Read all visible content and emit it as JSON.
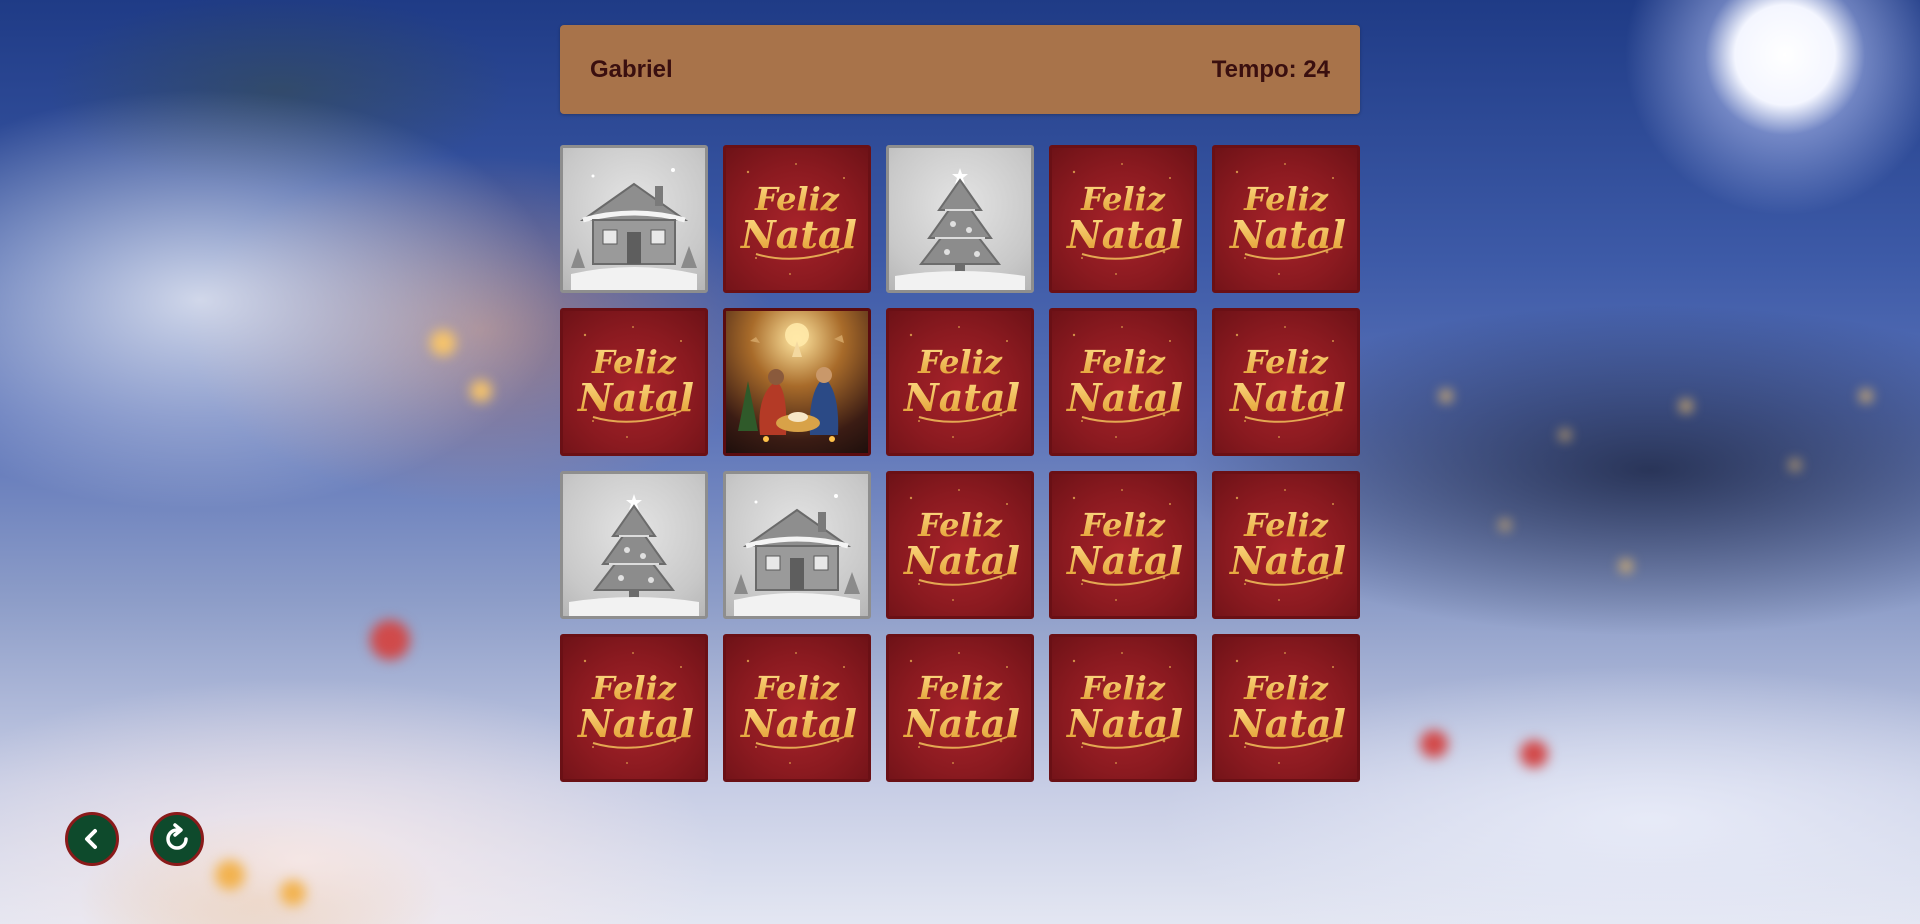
{
  "header": {
    "player_name": "Gabriel",
    "timer_label": "Tempo: 24"
  },
  "card_back_text": {
    "line1": "Feliz",
    "line2": "Natal"
  },
  "board": {
    "rows": 4,
    "columns": 5,
    "cards": [
      {
        "state": "matched",
        "image": "house-icon"
      },
      {
        "state": "hidden",
        "image": "feliz-natal-back"
      },
      {
        "state": "matched",
        "image": "christmas-tree-icon"
      },
      {
        "state": "hidden",
        "image": "feliz-natal-back"
      },
      {
        "state": "hidden",
        "image": "feliz-natal-back"
      },
      {
        "state": "hidden",
        "image": "feliz-natal-back"
      },
      {
        "state": "revealed",
        "image": "nativity-icon"
      },
      {
        "state": "hidden",
        "image": "feliz-natal-back"
      },
      {
        "state": "hidden",
        "image": "feliz-natal-back"
      },
      {
        "state": "hidden",
        "image": "feliz-natal-back"
      },
      {
        "state": "matched",
        "image": "christmas-tree-icon"
      },
      {
        "state": "matched",
        "image": "house-icon"
      },
      {
        "state": "hidden",
        "image": "feliz-natal-back"
      },
      {
        "state": "hidden",
        "image": "feliz-natal-back"
      },
      {
        "state": "hidden",
        "image": "feliz-natal-back"
      },
      {
        "state": "hidden",
        "image": "feliz-natal-back"
      },
      {
        "state": "hidden",
        "image": "feliz-natal-back"
      },
      {
        "state": "hidden",
        "image": "feliz-natal-back"
      },
      {
        "state": "hidden",
        "image": "feliz-natal-back"
      },
      {
        "state": "hidden",
        "image": "feliz-natal-back"
      }
    ]
  },
  "controls": {
    "back_icon": "chevron-left-icon",
    "restart_icon": "restart-icon"
  },
  "colors": {
    "header_bg": "#a8734a",
    "header_text": "#3a0f0f",
    "card_back": "#8b1a20",
    "card_text_gold": "#f2c15a",
    "button_bg": "#0e4a2c",
    "button_border": "#8a1a1a"
  }
}
